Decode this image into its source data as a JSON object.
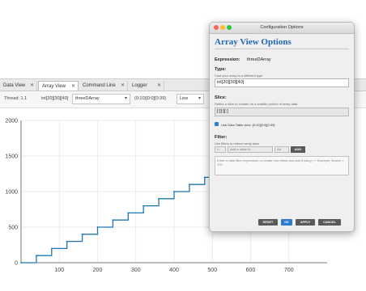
{
  "tabs": [
    {
      "label": "Data View"
    },
    {
      "label": "Array View",
      "active": true
    },
    {
      "label": "Command Line"
    },
    {
      "label": "Logger"
    }
  ],
  "toolbar": {
    "thread": "Thread: 1.1",
    "dims": "int[20][30][40]",
    "expression": "threeDArray",
    "slice": "(0:10)[0:0][0:39]",
    "view_mode": "Line"
  },
  "chart_data": {
    "type": "line",
    "title": "",
    "xlabel": "",
    "ylabel": "",
    "xlim": [
      0,
      800
    ],
    "ylim": [
      0,
      2000
    ],
    "x_ticks": [
      100,
      200,
      300,
      400,
      500,
      600,
      700
    ],
    "y_ticks": [
      0,
      500,
      1000,
      1500,
      2000
    ],
    "x_tick_labels": [
      "100",
      "200",
      "300",
      "400",
      "500",
      "600",
      "700"
    ],
    "y_tick_labels": [
      "0",
      "500",
      "1000",
      "1500",
      "2000"
    ],
    "series": [
      {
        "color": "#1f77b4",
        "step_width": 40,
        "x": [
          0,
          40,
          80,
          120,
          160,
          200,
          240,
          280,
          320,
          360,
          400,
          440,
          480
        ],
        "y": [
          0,
          100,
          200,
          300,
          400,
          500,
          600,
          700,
          800,
          900,
          1000,
          1100,
          1200
        ]
      }
    ]
  },
  "dialog": {
    "window_title": "Configuration Options",
    "heading": "Array View Options",
    "expression_label": "Expression:",
    "expression_value": "threeDArray",
    "type_label": "Type:",
    "type_hint": "Cast your array to a different type",
    "type_value": "int[20][30][40]",
    "slice_label": "Slice:",
    "slice_hint": "Define a slice to contain on a smaller portion of array data",
    "slice_value": "[:][:][:]",
    "slice_checkbox_label": "Use Data Table view: [0:10][0:0][0:39]",
    "filter_label": "Filter:",
    "filter_hint": "Use filters to reduce array data",
    "filter_op": "!=",
    "filter_value_placeholder": "Add a value to ...",
    "filter_logic": "AA",
    "filter_add": "ADD",
    "filter_textarea_placeholder": "Enter a valid filter expression or create new filters and add it using ++ Example: $value > 100",
    "buttons": {
      "reset": "RESET",
      "ok": "OK",
      "apply": "APPLY",
      "cancel": "CANCEL"
    }
  }
}
